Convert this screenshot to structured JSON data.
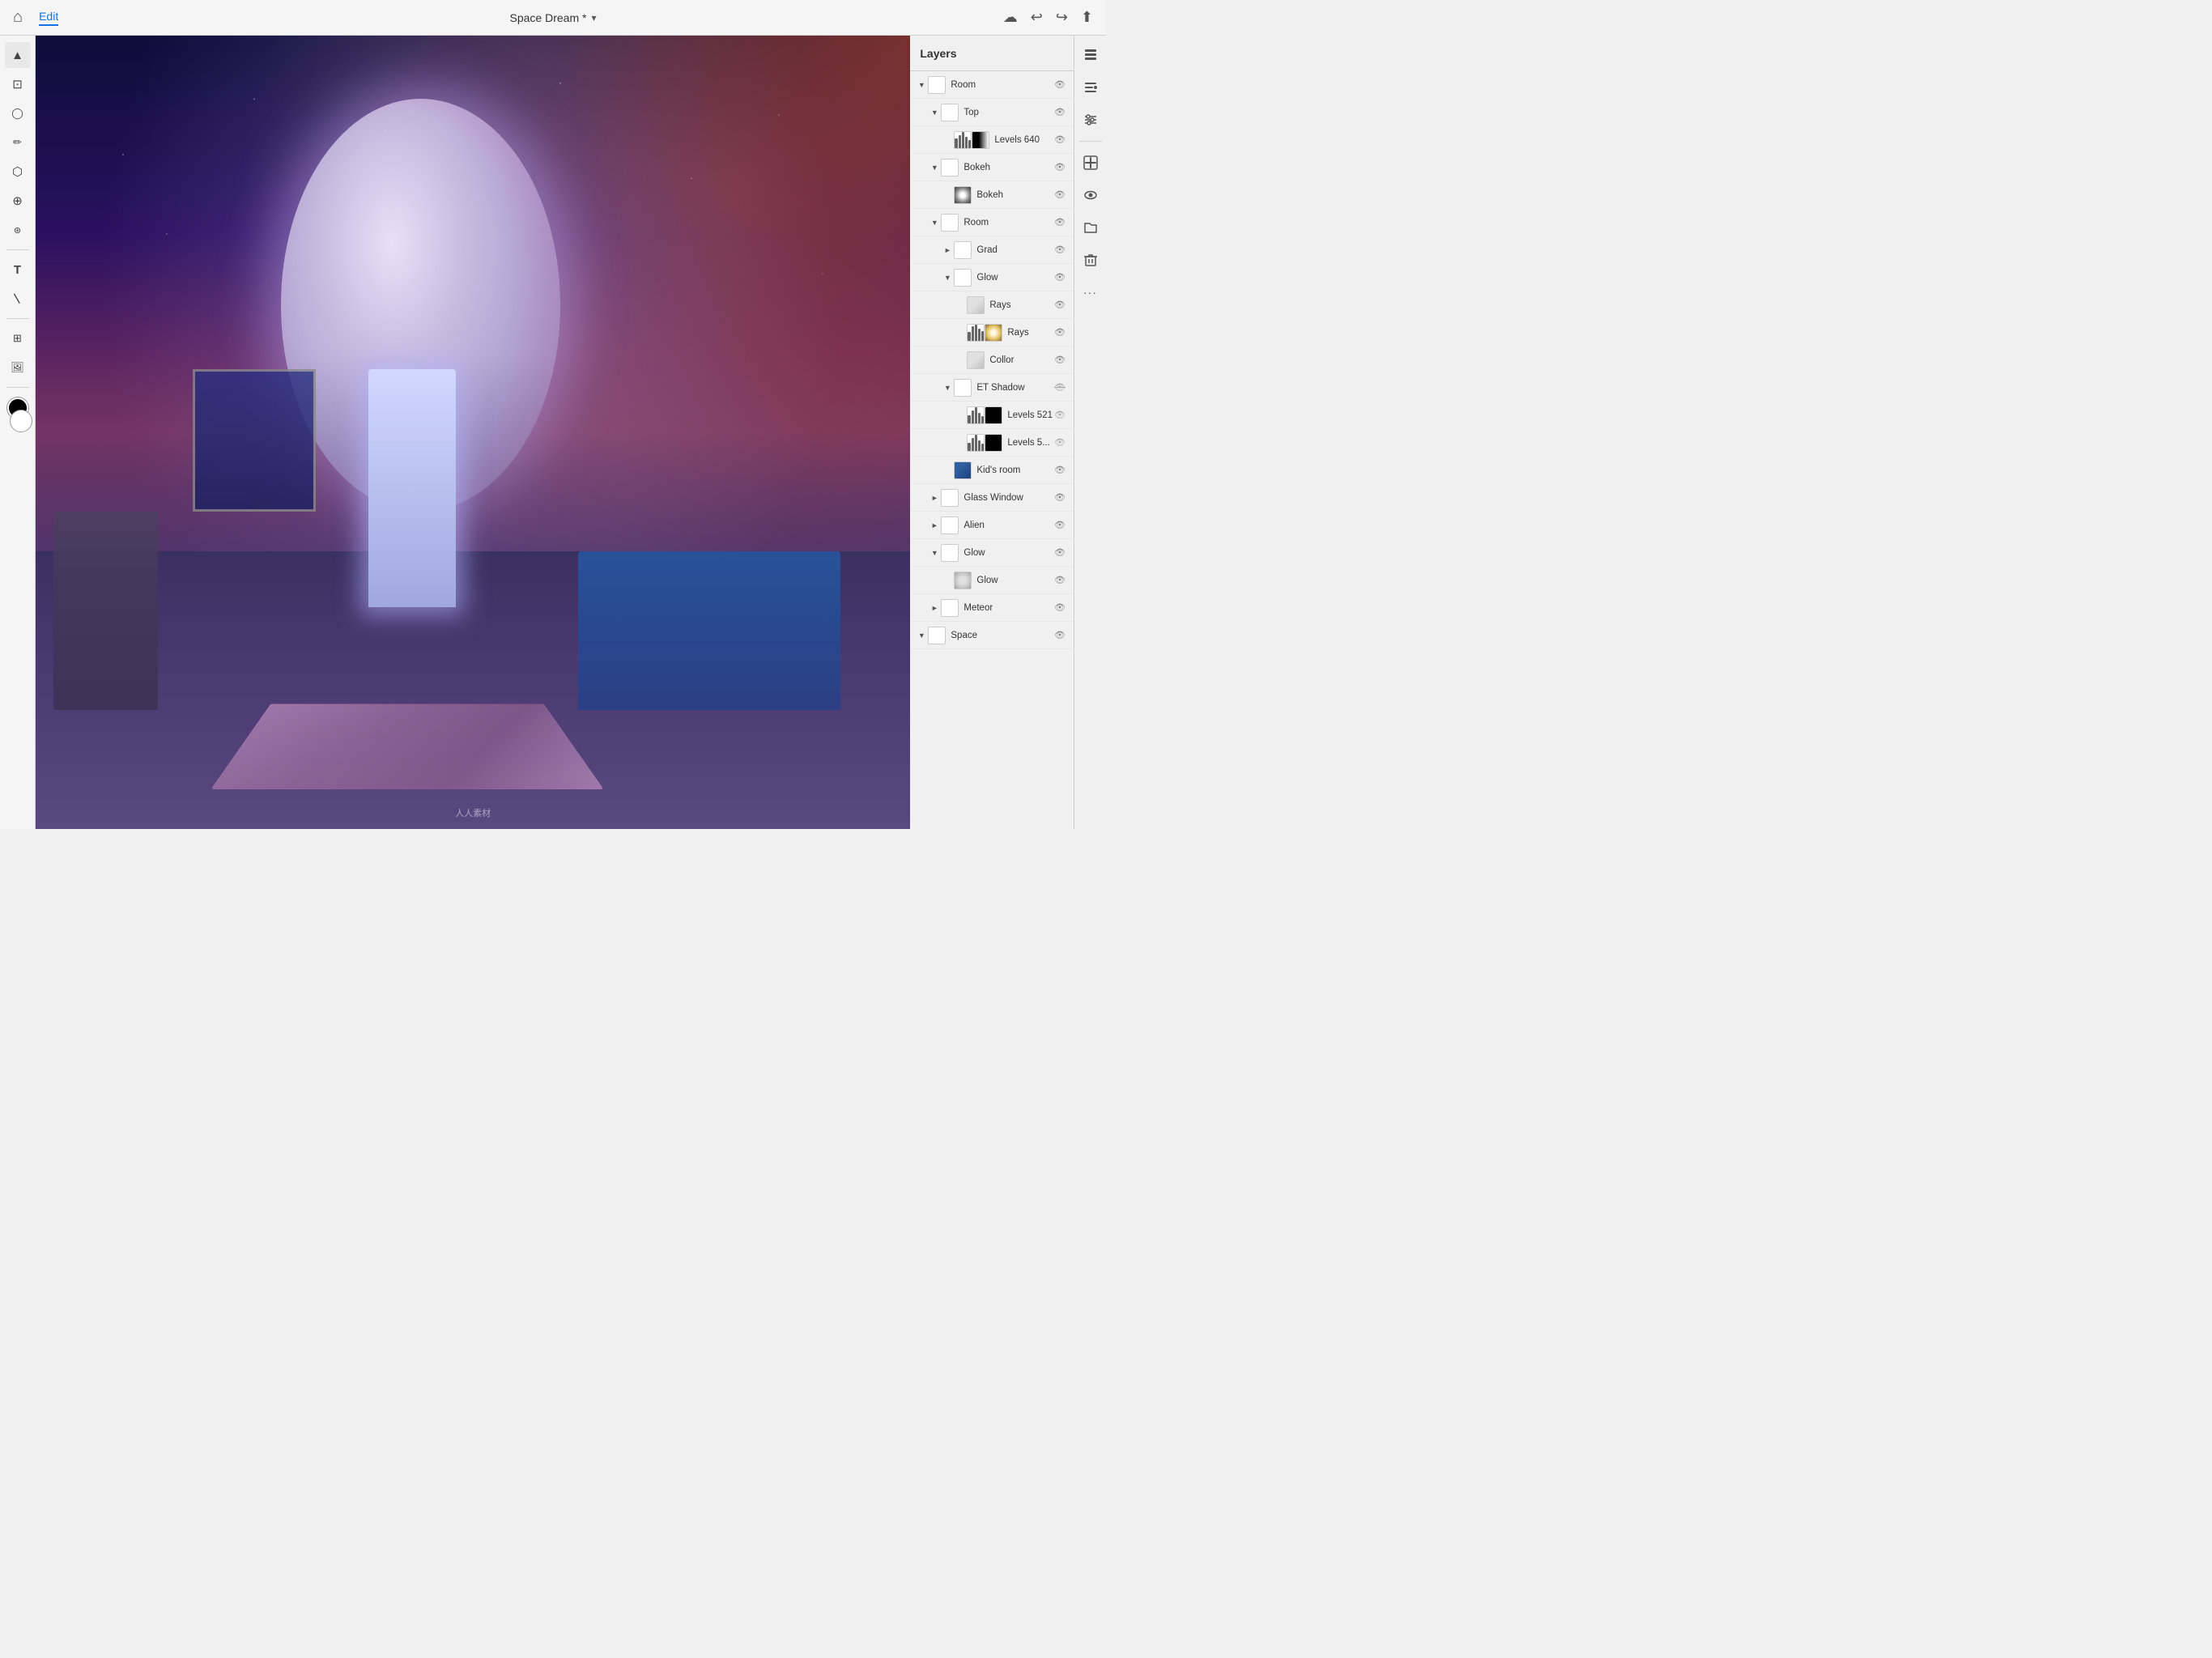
{
  "app": {
    "title": "Space Dream * ▾",
    "doc_title": "Space Dream *",
    "dropdown_symbol": "▾"
  },
  "top_bar": {
    "menu_items": [
      "Edit"
    ],
    "active_menu": "Edit",
    "right_icons": [
      "cloud",
      "undo",
      "redo",
      "share"
    ]
  },
  "layers_panel": {
    "title": "Layers",
    "layers": [
      {
        "id": "room-group",
        "name": "Room",
        "level": 0,
        "type": "group",
        "expanded": true,
        "arrow": "expanded",
        "visible": true
      },
      {
        "id": "top-group",
        "name": "Top",
        "level": 1,
        "type": "group",
        "expanded": true,
        "arrow": "expanded",
        "visible": true
      },
      {
        "id": "levels640",
        "name": "Levels 640",
        "level": 2,
        "type": "adjustment",
        "thumb": "levels",
        "visible": true
      },
      {
        "id": "bokeh-group",
        "name": "Bokeh",
        "level": 1,
        "type": "group",
        "expanded": true,
        "arrow": "expanded",
        "visible": true
      },
      {
        "id": "bokeh-layer",
        "name": "Bokeh",
        "level": 2,
        "type": "image",
        "thumb": "bokeh-img",
        "visible": true
      },
      {
        "id": "room-inner-group",
        "name": "Room",
        "level": 1,
        "type": "group",
        "expanded": true,
        "arrow": "expanded",
        "visible": true
      },
      {
        "id": "grad-group",
        "name": "Grad",
        "level": 2,
        "type": "group",
        "expanded": false,
        "arrow": "collapsed",
        "visible": true
      },
      {
        "id": "glow-group",
        "name": "Glow",
        "level": 2,
        "type": "group",
        "expanded": true,
        "arrow": "expanded",
        "visible": true
      },
      {
        "id": "rays-layer",
        "name": "Rays",
        "level": 3,
        "type": "image",
        "thumb": "collor-img",
        "visible": true
      },
      {
        "id": "rays-layer2",
        "name": "Rays",
        "level": 3,
        "type": "image-with-bars",
        "thumb": "rays-img",
        "visible": true
      },
      {
        "id": "collor-layer",
        "name": "Collor",
        "level": 3,
        "type": "image",
        "thumb": "collor-img",
        "visible": true
      },
      {
        "id": "etshadow-group",
        "name": "ET Shadow",
        "level": 2,
        "type": "group",
        "expanded": true,
        "arrow": "expanded",
        "visible": false
      },
      {
        "id": "levels521",
        "name": "Levels 521",
        "level": 3,
        "type": "adjustment",
        "thumb": "levels",
        "visible": false
      },
      {
        "id": "levels5",
        "name": "Levels 5...",
        "level": 3,
        "type": "adjustment",
        "thumb": "levels2",
        "visible": false
      },
      {
        "id": "kidsroom-layer",
        "name": "Kid's room",
        "level": 2,
        "type": "image",
        "thumb": "kidsroom-img",
        "visible": true
      },
      {
        "id": "glasswindow-group",
        "name": "Glass Window",
        "level": 1,
        "type": "group",
        "expanded": false,
        "arrow": "collapsed",
        "visible": true
      },
      {
        "id": "alien-group",
        "name": "Alien",
        "level": 1,
        "type": "group",
        "expanded": false,
        "arrow": "collapsed",
        "visible": true
      },
      {
        "id": "glow-group2",
        "name": "Glow",
        "level": 1,
        "type": "group",
        "expanded": true,
        "arrow": "expanded",
        "visible": true
      },
      {
        "id": "glow-layer",
        "name": "Glow",
        "level": 2,
        "type": "image",
        "thumb": "glow-img",
        "visible": true
      },
      {
        "id": "meteor-group",
        "name": "Meteor",
        "level": 1,
        "type": "group",
        "expanded": false,
        "arrow": "collapsed",
        "visible": true
      },
      {
        "id": "space-group",
        "name": "Space",
        "level": 0,
        "type": "group",
        "expanded": true,
        "arrow": "expanded",
        "visible": true
      }
    ]
  },
  "tools": [
    {
      "id": "select",
      "icon": "▲",
      "label": "Select"
    },
    {
      "id": "transform",
      "icon": "⊡",
      "label": "Transform"
    },
    {
      "id": "lasso",
      "icon": "◯",
      "label": "Lasso"
    },
    {
      "id": "brush",
      "icon": "✏",
      "label": "Brush"
    },
    {
      "id": "eraser",
      "icon": "⬡",
      "label": "Eraser"
    },
    {
      "id": "clone",
      "icon": "⊕",
      "label": "Clone"
    },
    {
      "id": "text",
      "icon": "T",
      "label": "Text"
    },
    {
      "id": "line",
      "icon": "/",
      "label": "Line"
    },
    {
      "id": "smart-object",
      "icon": "⊞",
      "label": "Smart Object"
    }
  ],
  "watermark": "人人素材",
  "right_panel_icons": [
    {
      "id": "layers",
      "icon": "≡",
      "label": "Layers"
    },
    {
      "id": "properties",
      "icon": "⊟",
      "label": "Properties"
    },
    {
      "id": "adjustments",
      "icon": "⊜",
      "label": "Adjustments"
    },
    {
      "id": "add",
      "icon": "+",
      "label": "Add"
    },
    {
      "id": "visibility",
      "icon": "◎",
      "label": "Visibility"
    },
    {
      "id": "folders",
      "icon": "▣",
      "label": "Folders"
    },
    {
      "id": "delete",
      "icon": "🗑",
      "label": "Delete"
    },
    {
      "id": "more",
      "icon": "···",
      "label": "More"
    }
  ]
}
